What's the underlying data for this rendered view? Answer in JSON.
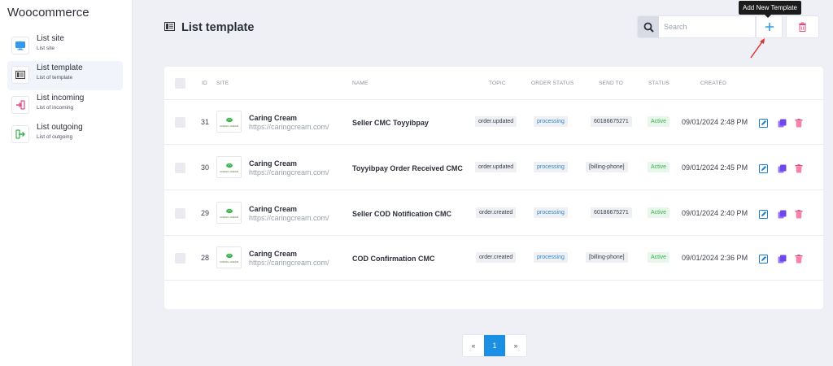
{
  "sidebar": {
    "brand": "Woocommerce",
    "items": [
      {
        "title": "List site",
        "subtitle": "List site",
        "icon": "monitor-icon"
      },
      {
        "title": "List template",
        "subtitle": "List of template",
        "icon": "template-icon"
      },
      {
        "title": "List incoming",
        "subtitle": "List of incoming",
        "icon": "incoming-icon"
      },
      {
        "title": "List outgoing",
        "subtitle": "List of outgoing",
        "icon": "outgoing-icon"
      }
    ]
  },
  "header": {
    "title": "List template",
    "search_placeholder": "Search",
    "add_tooltip": "Add New Template"
  },
  "table": {
    "columns": [
      "ID",
      "SITE",
      "NAME",
      "TOPIC",
      "ORDER STATUS",
      "SEND TO",
      "STATUS",
      "CREATED"
    ],
    "rows": [
      {
        "id": "31",
        "site_name": "Caring Cream",
        "site_url": "https://caringcream.com/",
        "name": "Seller CMC Toyyibpay",
        "topic": "order.updated",
        "order_status": "processing",
        "send_to": "60186675271",
        "status": "Active",
        "created": "09/01/2024 2:48 PM"
      },
      {
        "id": "30",
        "site_name": "Caring Cream",
        "site_url": "https://caringcream.com/",
        "name": "Toyyibpay Order Received CMC",
        "topic": "order.updated",
        "order_status": "processing",
        "send_to": "[billing-phone]",
        "status": "Active",
        "created": "09/01/2024 2:45 PM"
      },
      {
        "id": "29",
        "site_name": "Caring Cream",
        "site_url": "https://caringcream.com/",
        "name": "Seller COD Notification CMC",
        "topic": "order.created",
        "order_status": "processing",
        "send_to": "60186675271",
        "status": "Active",
        "created": "09/01/2024 2:40 PM"
      },
      {
        "id": "28",
        "site_name": "Caring Cream",
        "site_url": "https://caringcream.com/",
        "name": "COD Confirmation CMC",
        "topic": "order.created",
        "order_status": "processing",
        "send_to": "[billing-phone]",
        "status": "Active",
        "created": "09/01/2024 2:36 PM"
      }
    ],
    "logo_text": "CARING CREAM"
  },
  "pagination": {
    "prev": "«",
    "current": "1",
    "next": "»"
  },
  "colors": {
    "accent": "#1a8fe3",
    "active_green": "#37b24d",
    "delete_red": "#e64980",
    "edit_blue": "#1c7ed6",
    "copy_purple": "#7048e8"
  }
}
